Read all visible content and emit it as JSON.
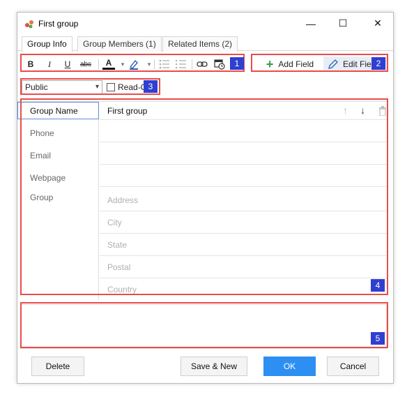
{
  "window": {
    "title": "First group",
    "min_glyph": "—",
    "max_glyph": "☐",
    "close_glyph": "✕"
  },
  "tabs": [
    {
      "label": "Group Info"
    },
    {
      "label": "Group Members (1)"
    },
    {
      "label": "Related Items  (2)"
    }
  ],
  "toolbar": {
    "bold": "B",
    "italic": "I",
    "underline": "U",
    "strike": "abc",
    "font_color": "A",
    "dropdown": "▾",
    "add_field": "Add Field",
    "edit_field": "Edit Fie"
  },
  "privacy": {
    "selected": "Public",
    "readonly_label": "Read-O"
  },
  "badges": [
    "1",
    "2",
    "3",
    "4",
    "5"
  ],
  "form": {
    "labels": {
      "group_name": "Group Name",
      "phone": "Phone",
      "email": "Email",
      "webpage": "Webpage",
      "group": "Group"
    },
    "group_name_value": "First group",
    "address_placeholders": [
      "Address",
      "City",
      "State",
      "Postal",
      "Country"
    ]
  },
  "buttons": {
    "delete": "Delete",
    "save_new": "Save & New",
    "ok": "OK",
    "cancel": "Cancel"
  },
  "colors": {
    "highlight": "#ea4b4b",
    "badge": "#2f3fd0",
    "primary": "#2e8ff3"
  }
}
